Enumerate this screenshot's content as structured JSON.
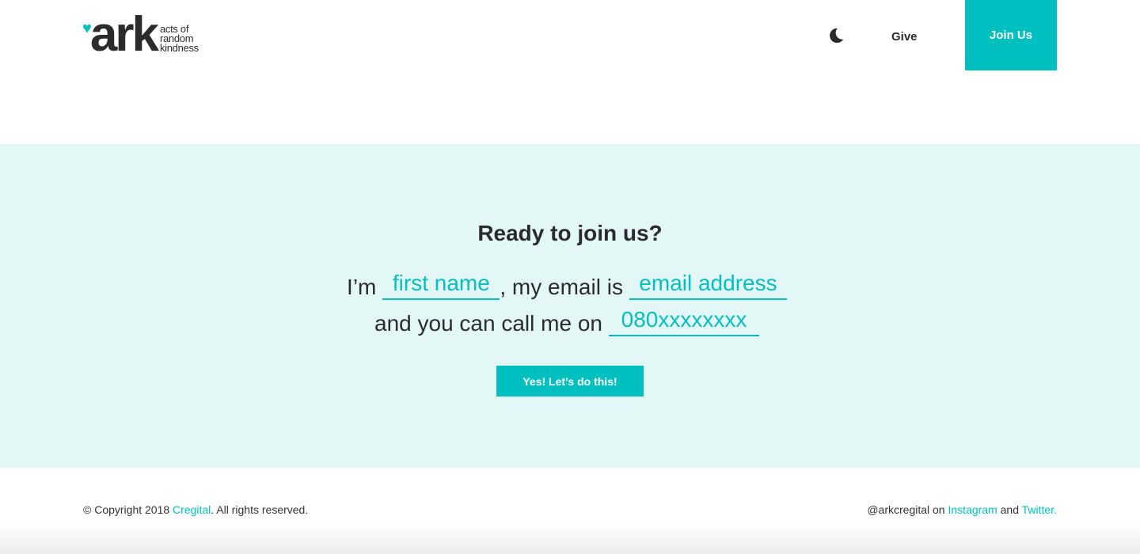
{
  "header": {
    "logo": {
      "wordmark": "ark",
      "tagline": [
        "acts of",
        "random",
        "kindness"
      ]
    },
    "theme_icon": "moon-icon",
    "give_label": "Give",
    "join_label": "Join Us"
  },
  "cta": {
    "title": "Ready to join us?",
    "prefix": "I’m",
    "first_name_placeholder": "first name",
    "email_text": ", my email is",
    "email_placeholder": "email address",
    "phone_text": "and you can call me on",
    "phone_placeholder": "080xxxxxxxx",
    "submit_label": "Yes! Let’s do this!"
  },
  "footer": {
    "copyright_prefix": "© Copyright 2018",
    "company_link": "Cregital",
    "copyright_suffix": ". All rights reserved.",
    "handle": "@arkcregital on",
    "instagram": "Instagram",
    "and": "and",
    "twitter": "Twitter."
  },
  "colors": {
    "accent": "#00bfbf",
    "cta_bg": "#e3f7f6",
    "text": "#2b2b2b"
  }
}
